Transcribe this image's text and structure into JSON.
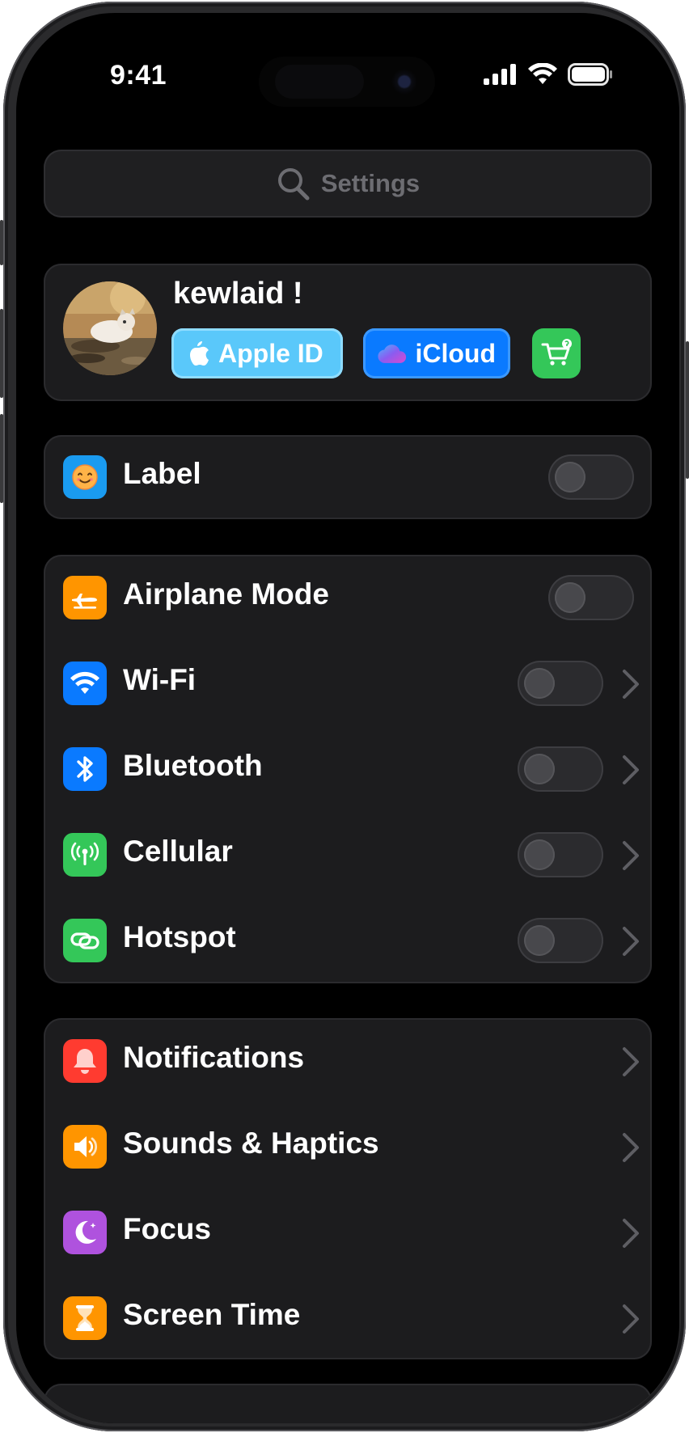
{
  "status_bar": {
    "time": "9:41"
  },
  "search": {
    "placeholder": "Settings"
  },
  "profile": {
    "name": "kewlaid !",
    "apple_id_label": "Apple ID",
    "icloud_label": "iCloud"
  },
  "group_label": {
    "label": "Label",
    "icon": "smiley-face-icon",
    "color": "#1a9bf0"
  },
  "group_connectivity": [
    {
      "label": "Airplane Mode",
      "icon": "airplane-icon",
      "color": "#ff9500"
    },
    {
      "label": "Wi-Fi",
      "icon": "wifi-icon",
      "color": "#0a7aff"
    },
    {
      "label": "Bluetooth",
      "icon": "bluetooth-icon",
      "color": "#0a7aff"
    },
    {
      "label": "Cellular",
      "icon": "antenna-icon",
      "color": "#34c759"
    },
    {
      "label": "Hotspot",
      "icon": "link-chain-icon",
      "color": "#34c759"
    }
  ],
  "group_system": [
    {
      "label": "Notifications",
      "icon": "bell-icon",
      "color": "#ff3b30"
    },
    {
      "label": "Sounds & Haptics",
      "icon": "speaker-icon",
      "color": "#ff9500"
    },
    {
      "label": "Focus",
      "icon": "moon-icon",
      "color": "#af52de"
    },
    {
      "label": "Screen Time",
      "icon": "hourglass-icon",
      "color": "#ff9500"
    }
  ]
}
